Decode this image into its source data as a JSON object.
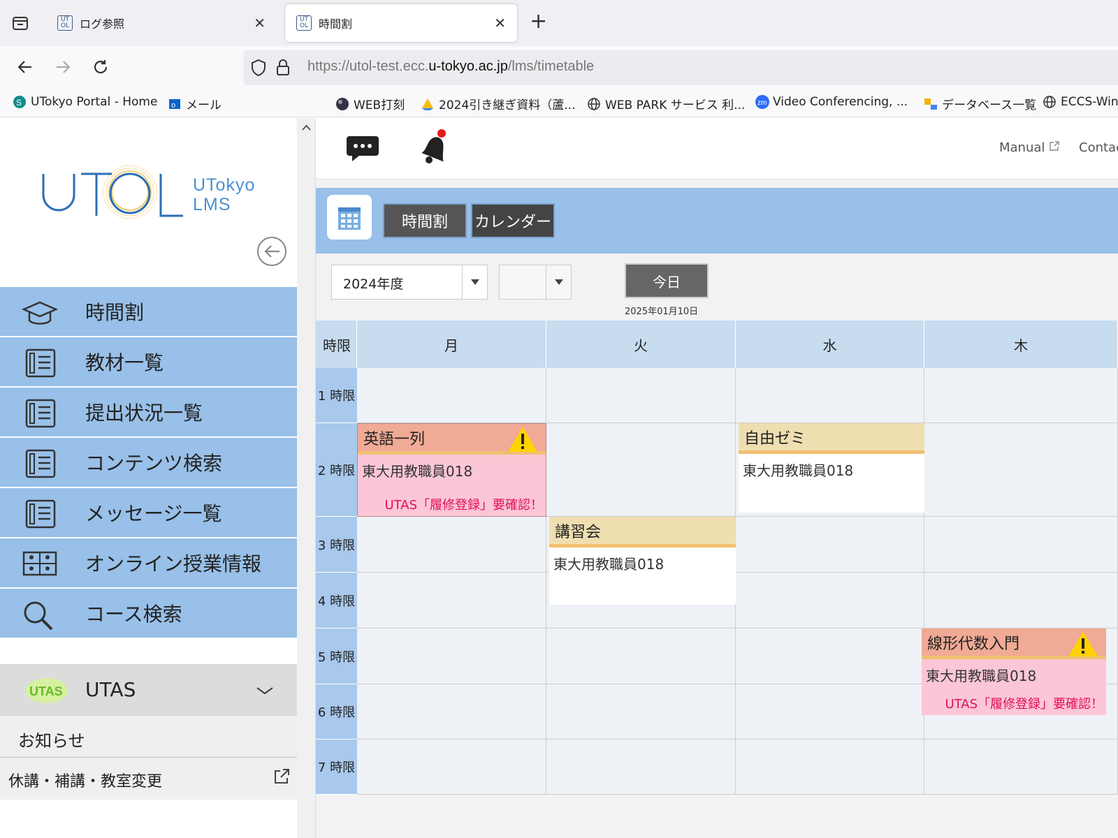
{
  "browser": {
    "tabs": [
      {
        "label": "ログ参照",
        "favicon": "UT OL",
        "active": false
      },
      {
        "label": "時間割",
        "favicon": "UT OL",
        "active": true
      }
    ],
    "url_prefix": "https://utol-test.ecc.",
    "url_domain": "u-tokyo.ac.jp",
    "url_path": "/lms/timetable",
    "bookmarks": [
      {
        "label": "UTokyo Portal - Home",
        "icon": "sharepoint-icon"
      },
      {
        "label": "メール",
        "icon": "outlook-icon"
      },
      {
        "label": "WEB打刻",
        "icon": "globe-ball-icon"
      },
      {
        "label": "2024引き継ぎ資料（蘆...",
        "icon": "google-drive-icon"
      },
      {
        "label": "WEB PARK サービス 利...",
        "icon": "globe-icon"
      },
      {
        "label": "Video Conferencing, ...",
        "icon": "zoom-icon"
      },
      {
        "label": "データベース一覧",
        "icon": "database-icon"
      },
      {
        "label": "ECCS-Win",
        "icon": "globe-icon"
      }
    ]
  },
  "sidebar": {
    "logo_main": "UTOL",
    "logo_sub1": "UTokyo",
    "logo_sub2": "LMS",
    "menu": [
      {
        "label": "時間割",
        "icon": "graduation-cap-icon"
      },
      {
        "label": "教材一覧",
        "icon": "clipboard-icon"
      },
      {
        "label": "提出状況一覧",
        "icon": "clipboard-icon"
      },
      {
        "label": "コンテンツ検索",
        "icon": "clipboard-icon"
      },
      {
        "label": "メッセージ一覧",
        "icon": "clipboard-icon"
      },
      {
        "label": "オンライン授業情報",
        "icon": "online-class-icon"
      },
      {
        "label": "コース検索",
        "icon": "search-icon"
      }
    ],
    "utas_label": "UTAS",
    "utas_logo": "UTAS",
    "notice_label": "お知らせ",
    "kyuko_label": "休講・補講・教室変更"
  },
  "header": {
    "manual_label": "Manual",
    "contact_label": "Contac"
  },
  "toolbar": {
    "timetable_btn": "時間割",
    "calendar_btn": "カレンダー",
    "year_select": "2024年度",
    "term_select": "",
    "today_btn": "今日",
    "today_date": "2025年01月10日"
  },
  "timetable": {
    "period_header": "時限",
    "days": [
      "月",
      "火",
      "水",
      "木"
    ],
    "periods": [
      "1 時限",
      "2 時限",
      "3 時限",
      "4 時限",
      "5 時限",
      "6 時限",
      "7 時限"
    ],
    "courses": [
      {
        "name": "英語一列",
        "teacher": "東大用教職員018",
        "warning": "UTAS「履修登録」要確認！",
        "style": "pink",
        "has_alert": true
      },
      {
        "name": "自由ゼミ",
        "teacher": "東大用教職員018",
        "warning": "",
        "style": "white",
        "has_alert": false
      },
      {
        "name": "講習会",
        "teacher": "東大用教職員018",
        "warning": "",
        "style": "white",
        "has_alert": false
      },
      {
        "name": "線形代数入門",
        "teacher": "東大用教職員018",
        "warning": "UTAS「履修登録」要確認！",
        "style": "pink",
        "has_alert": true
      }
    ]
  },
  "colors": {
    "menu_bg": "#98c0e8",
    "pink_course": "#fbc6d6",
    "warning_text": "#e0105a"
  }
}
